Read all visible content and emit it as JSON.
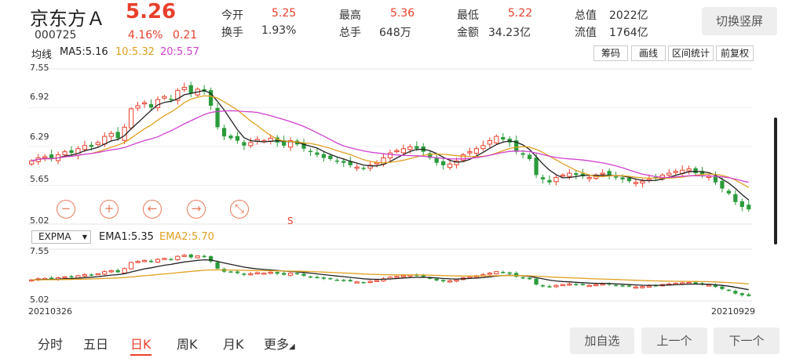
{
  "stock": {
    "name": "京东方Ａ",
    "price": "5.26",
    "code": "000725",
    "change_pct": "4.16%",
    "change": "0.21",
    "stats": [
      {
        "label": "今开",
        "value": "5.25",
        "color": "red"
      },
      {
        "label": "最高",
        "value": "5.36",
        "color": "red"
      },
      {
        "label": "最低",
        "value": "5.22",
        "color": "red"
      },
      {
        "label": "总值",
        "value": "2022亿",
        "color": "plain"
      },
      {
        "label": "换手",
        "value": "1.93%",
        "color": "plain"
      },
      {
        "label": "总手",
        "value": "648万",
        "color": "plain"
      },
      {
        "label": "金额",
        "value": "34.23亿",
        "color": "plain"
      },
      {
        "label": "流值",
        "value": "1764亿",
        "color": "plain"
      }
    ],
    "switch_label": "切换竖屏"
  },
  "ma": {
    "label": "均线",
    "ma5": "MA5:5.16",
    "ma10": "10:5.32",
    "ma20": "20:5.57",
    "colors": {
      "ma5": "#222222",
      "ma10": "#e0a020",
      "ma20": "#d040d0"
    }
  },
  "toolbar": [
    "筹码",
    "画线",
    "区间统计",
    "前复权"
  ],
  "main_axis": [
    "7.55",
    "6.92",
    "6.29",
    "5.65",
    "5.02"
  ],
  "controls": [
    {
      "icon": "zoom-out-icon",
      "glyph": "−"
    },
    {
      "icon": "zoom-in-icon",
      "glyph": "+"
    },
    {
      "icon": "arrow-left-icon",
      "glyph": "←"
    },
    {
      "icon": "arrow-right-icon",
      "glyph": "→"
    },
    {
      "icon": "shrink-icon",
      "glyph": "⤡"
    }
  ],
  "marker": "S",
  "expma": {
    "selector": "EXPMA",
    "ema1": "EMA1:5.35",
    "ema2": "EMA2:5.70",
    "axis_top": "7.55",
    "axis_bottom": "5.02"
  },
  "dates": {
    "start": "20210326",
    "end": "20210929"
  },
  "tabs": [
    {
      "label": "分时",
      "active": false
    },
    {
      "label": "五日",
      "active": false
    },
    {
      "label": "日K",
      "active": true
    },
    {
      "label": "周K",
      "active": false
    },
    {
      "label": "月K",
      "active": false
    },
    {
      "label": "更多",
      "active": false
    }
  ],
  "actions": [
    "加自选",
    "上一个",
    "下一个"
  ],
  "chart_data": {
    "type": "candlestick",
    "ylim": [
      5.02,
      7.55
    ],
    "closes": [
      6.05,
      6.1,
      6.12,
      6.08,
      6.15,
      6.2,
      6.18,
      6.25,
      6.3,
      6.28,
      6.35,
      6.45,
      6.5,
      6.42,
      6.6,
      6.9,
      6.95,
      7.0,
      6.92,
      7.05,
      7.1,
      7.05,
      7.2,
      7.25,
      7.15,
      7.22,
      7.18,
      6.95,
      6.6,
      6.45,
      6.42,
      6.38,
      6.3,
      6.35,
      6.4,
      6.38,
      6.42,
      6.35,
      6.3,
      6.38,
      6.32,
      6.25,
      6.2,
      6.15,
      6.1,
      6.08,
      6.05,
      6.02,
      5.98,
      5.95,
      5.92,
      5.98,
      6.02,
      6.1,
      6.18,
      6.22,
      6.25,
      6.28,
      6.25,
      6.2,
      6.1,
      6.02,
      5.98,
      6.0,
      6.05,
      6.15,
      6.2,
      6.25,
      6.3,
      6.38,
      6.45,
      6.4,
      6.35,
      6.2,
      6.15,
      6.08,
      5.82,
      5.75,
      5.7,
      5.78,
      5.82,
      5.85,
      5.82,
      5.8,
      5.78,
      5.82,
      5.85,
      5.82,
      5.78,
      5.75,
      5.72,
      5.7,
      5.72,
      5.75,
      5.78,
      5.82,
      5.85,
      5.88,
      5.9,
      5.92,
      5.85,
      5.82,
      5.8,
      5.7,
      5.6,
      5.52,
      5.38,
      5.3,
      5.26
    ]
  }
}
